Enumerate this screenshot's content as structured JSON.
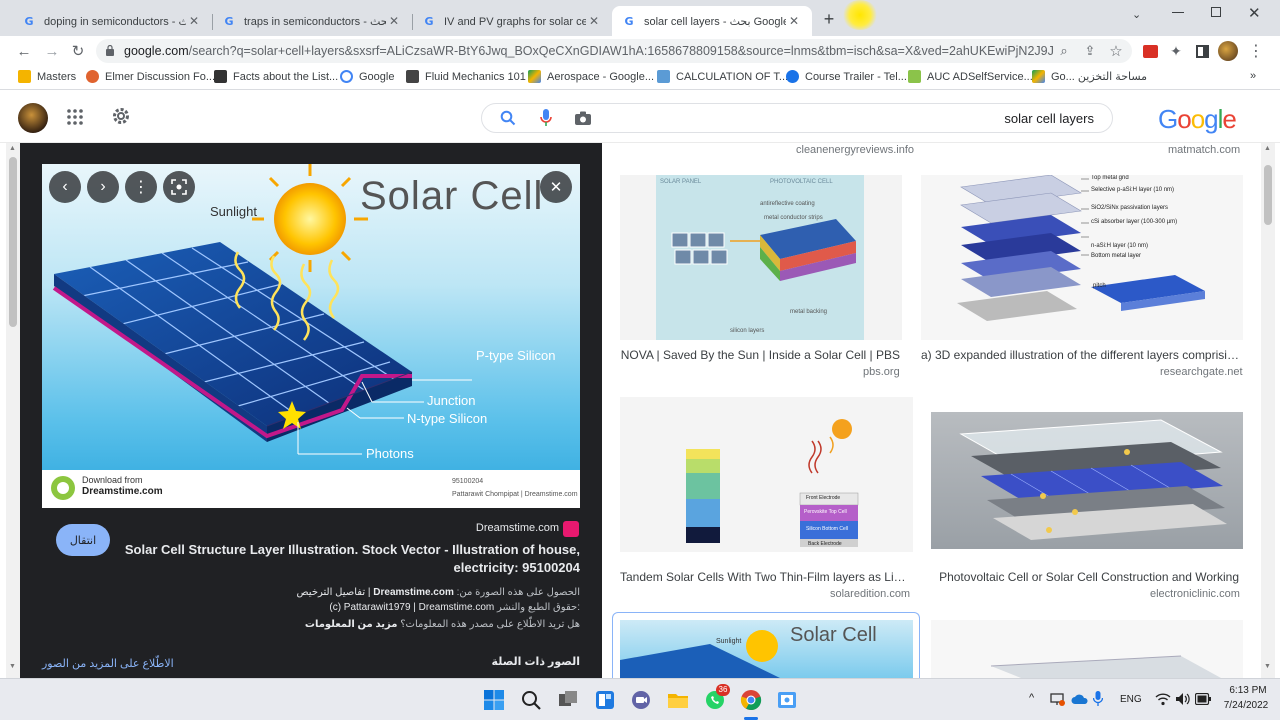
{
  "tabs": [
    {
      "title": "doping in semiconductors - بحث Google",
      "active": false
    },
    {
      "title": "traps in semiconductors - بحث Google",
      "active": false
    },
    {
      "title": "IV and PV graphs for solar cell - بحث Google",
      "active": false
    },
    {
      "title": "solar cell layers - بحث Google",
      "active": true
    }
  ],
  "toolbar": {
    "url_host": "google.com",
    "url_rest": "/search?q=solar+cell+layers&sxsrf=ALiCzsaWR-BtY6Jwq_BOxQeCXnGDIAW1hA:1658678809158&source=lnms&tbm=isch&sa=X&ved=2ahUKEwiPjN2J9JH5AhWlzlUKHX9-CtkQ_AUoAXoECAEQAw"
  },
  "bookmarks": [
    {
      "label": "Masters",
      "color": "#f4b400"
    },
    {
      "label": "Elmer Discussion Fo...",
      "color": "#e0632f"
    },
    {
      "label": "Facts about the List...",
      "color": "#333333"
    },
    {
      "label": "Google",
      "color": "#4285f4"
    },
    {
      "label": "Fluid Mechanics 101",
      "color": "#444444"
    },
    {
      "label": "Aerospace - Google...",
      "color": "#0f9d58"
    },
    {
      "label": "CALCULATION OF T...",
      "color": "#5b9bd5"
    },
    {
      "label": "Course Trailer - Tel...",
      "color": "#1a73e8"
    },
    {
      "label": "AUC ADSelfService...",
      "color": "#8bc34a"
    },
    {
      "label": "Go... مساحة التخزين",
      "color": "#0f9d58"
    }
  ],
  "search": {
    "query": "solar cell layers"
  },
  "logo": "Google",
  "preview": {
    "image_title": "Solar Cell",
    "labels": [
      "Sunlight",
      "P-type Silicon",
      "Junction",
      "N-type Silicon",
      "Photons"
    ],
    "watermark_title": "Download from",
    "watermark_brand": "Dreamstime.com",
    "watermark_id": "95100204",
    "watermark_credit": "Pattarawit Chompipat | Dreamstime.com",
    "visit_button": "انتقال",
    "source": "Dreamstime.com",
    "title": "Solar Cell Structure Layer Illustration. Stock Vector - Illustration of house, electricity: 95100204",
    "line1_label": "الحصول على هذه الصورة من:",
    "line1_value": "Dreamstime.com",
    "line1_tail": "| تفاصيل الترخيص",
    "line2_label": "حقوق الطبع والنشر:",
    "line2_value": "(c) Pattarawit1979 | Dreamstime.com",
    "line3_label": "هل تريد الاطّلاع على مصدر هذه المعلومات؟",
    "line3_link": "مزيد من المعلومات",
    "related_heading": "الصور ذات الصلة",
    "see_more": "الاطّلاع على المزيد من الصور"
  },
  "results": [
    {
      "caption": "",
      "source": "cleanenergyreviews.info"
    },
    {
      "caption": "",
      "source": "matmatch.com"
    },
    {
      "caption": "NOVA | Saved By the Sun | Inside a Solar Cell | PBS",
      "source": "pbs.org"
    },
    {
      "caption": "a) 3D expanded illustration of the different layers comprising...",
      "source": "researchgate.net"
    },
    {
      "caption": "Tandem Solar Cells With Two Thin-Film layers as Light ...",
      "source": "solaredition.com"
    },
    {
      "caption": "Photovoltaic Cell or Solar Cell Construction and Working",
      "source": "electroniclinic.com"
    }
  ],
  "thumb_texts": {
    "nova_left": "SOLAR PANEL",
    "nova_right": "PHOTOVOLTAIC CELL",
    "nova_1": "antireflective coating",
    "nova_2": "metal conductor strips",
    "nova_3": "metal backing",
    "nova_4": "silicon layers",
    "rg_1": "Top metal grid",
    "rg_2": "Selective p-aSi:H layer (10 nm)",
    "rg_3": "SiO2/SiNx passivation layers",
    "rg_4": "cSi absorber layer (100-300 µm)",
    "rg_5": "n-aSi:H layer (10 nm)",
    "rg_6": "Bottom metal layer",
    "rg_7": "pitch",
    "tandem_1": "Front Electrode",
    "tandem_2": "Perovskite Top Cell",
    "tandem_3": "Silicon Bottom Cell",
    "tandem_4": "Back Electrode",
    "next_title": "Solar Cell",
    "next_sun": "Sunlight"
  },
  "taskbar": {
    "lang": "ENG",
    "time": "6:13 PM",
    "date": "7/24/2022",
    "badge": "36"
  }
}
